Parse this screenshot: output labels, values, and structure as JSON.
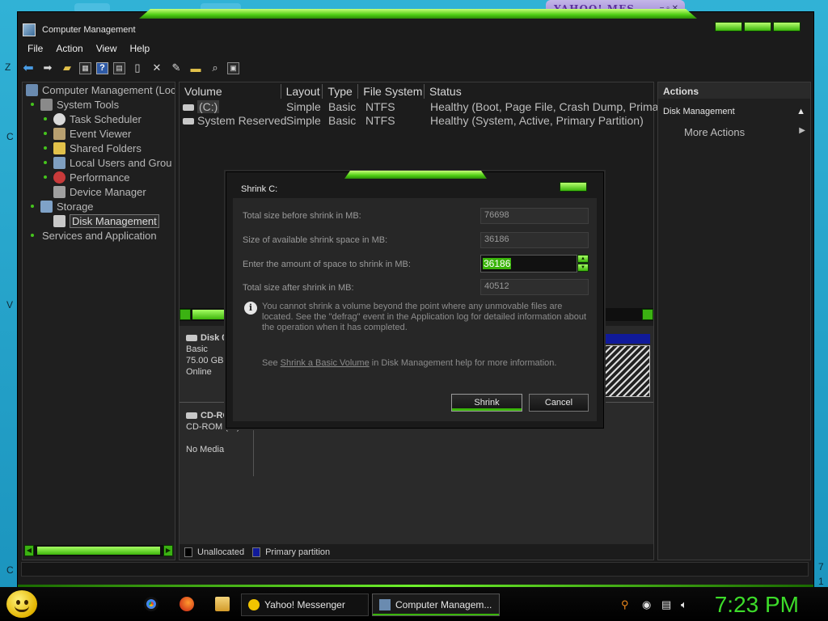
{
  "window": {
    "title": "Computer Management"
  },
  "menu": [
    "File",
    "Action",
    "View",
    "Help"
  ],
  "tree": {
    "root": "Computer Management (Loc",
    "items": [
      {
        "label": "System Tools"
      },
      {
        "label": "Task Scheduler"
      },
      {
        "label": "Event Viewer"
      },
      {
        "label": "Shared Folders"
      },
      {
        "label": "Local Users and Grou"
      },
      {
        "label": "Performance"
      },
      {
        "label": "Device Manager"
      },
      {
        "label": "Storage"
      },
      {
        "label": "Disk Management"
      },
      {
        "label": "Services and Application"
      }
    ]
  },
  "volumes": {
    "columns": [
      "Volume",
      "Layout",
      "Type",
      "File System",
      "Status"
    ],
    "rows": [
      {
        "volume": "(C:)",
        "layout": "Simple",
        "type": "Basic",
        "fs": "NTFS",
        "status": "Healthy (Boot, Page File, Crash Dump, Primary"
      },
      {
        "volume": "System Reserved",
        "layout": "Simple",
        "type": "Basic",
        "fs": "NTFS",
        "status": "Healthy (System, Active, Primary Partition)"
      }
    ]
  },
  "disks": [
    {
      "name": "Disk 0",
      "type": "Basic",
      "size": "75.00 GB",
      "state": "Online"
    },
    {
      "name": "CD-ROM 0",
      "type": "CD-ROM (D:)",
      "state": "No Media"
    }
  ],
  "legend": {
    "unallocated": "Unallocated",
    "primary": "Primary partition"
  },
  "actions": {
    "header": "Actions",
    "section": "Disk Management",
    "more": "More Actions"
  },
  "dialog": {
    "title": "Shrink C:",
    "label_total_before": "Total size before shrink in MB:",
    "value_total_before": "76698",
    "label_available": "Size of available shrink space in MB:",
    "value_available": "36186",
    "label_amount": "Enter the amount of space to shrink in MB:",
    "value_amount": "36186",
    "label_total_after": "Total size after shrink in MB:",
    "value_total_after": "40512",
    "info": "You cannot shrink a volume beyond the point where any unmovable files are located. See the \"defrag\" event in the Application log for detailed information about the operation when it has completed.",
    "see_prefix": "See",
    "see_link": "Shrink a Basic Volume",
    "see_suffix": "in Disk Management help for more information.",
    "shrink_button": "Shrink",
    "cancel_button": "Cancel"
  },
  "taskbar": {
    "yahoo": "Yahoo! Messenger",
    "compmgmt": "Computer Managem...",
    "clock": "7:23 PM"
  },
  "yahoo_window": {
    "title": "YAHOO! MES"
  },
  "colors": {
    "accent_green": "#3ab40a",
    "clock_green": "#3ddc2a",
    "primary_partition": "#101a9a"
  }
}
